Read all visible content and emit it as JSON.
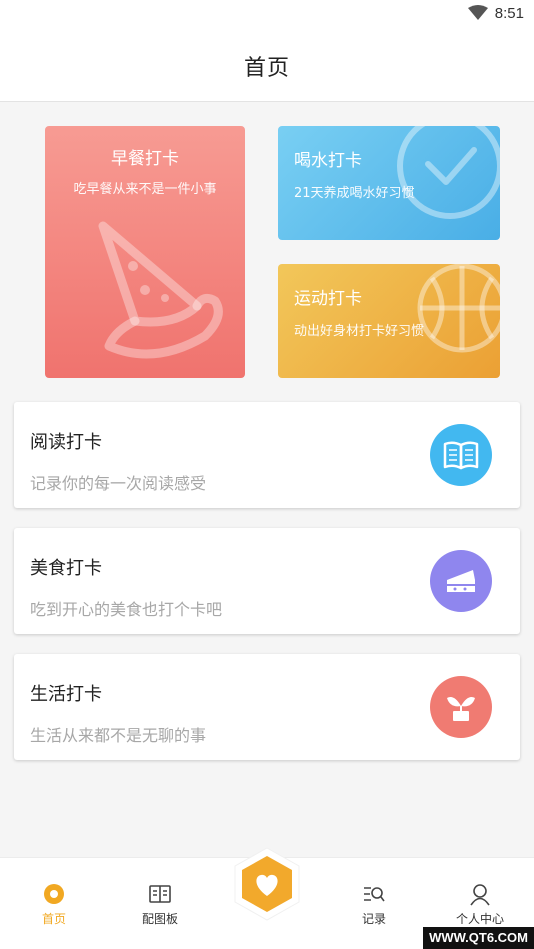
{
  "status_bar": {
    "time": "8:51",
    "wifi_icon": "wifi-icon"
  },
  "nav": {
    "title": "首页"
  },
  "cards": {
    "breakfast": {
      "title": "早餐打卡",
      "subtitle": "吃早餐从来不是一件小事",
      "icon": "pizza-slice-icon"
    },
    "water": {
      "title": "喝水打卡",
      "subtitle": "21天养成喝水好习惯",
      "icon": "check-circle-icon"
    },
    "sport": {
      "title": "运动打卡",
      "subtitle": "动出好身材打卡好习惯",
      "icon": "basketball-icon"
    }
  },
  "list": [
    {
      "title": "阅读打卡",
      "subtitle": "记录你的每一次阅读感受",
      "icon": "open-book-icon",
      "icon_color": "#42b8f0"
    },
    {
      "title": "美食打卡",
      "subtitle": "吃到开心的美食也打个卡吧",
      "icon": "cake-slice-icon",
      "icon_color": "#8f86ee"
    },
    {
      "title": "生活打卡",
      "subtitle": "生活从来都不是无聊的事",
      "icon": "sprout-pot-icon",
      "icon_color": "#f07b72"
    }
  ],
  "tabs": [
    {
      "label": "首页",
      "icon": "home-dot-icon",
      "active": true
    },
    {
      "label": "配图板",
      "icon": "gallery-board-icon",
      "active": false
    },
    {
      "label": "",
      "icon": "heart-hexagon-icon",
      "active": false
    },
    {
      "label": "记录",
      "icon": "search-list-icon",
      "active": false
    },
    {
      "label": "个人中心",
      "icon": "person-icon",
      "active": false
    }
  ],
  "colors": {
    "accent": "#f1a822",
    "breakfast": "#f2817a",
    "water": "#5fbdec",
    "sport": "#efb545"
  },
  "watermark": "WWW.QT6.COM"
}
